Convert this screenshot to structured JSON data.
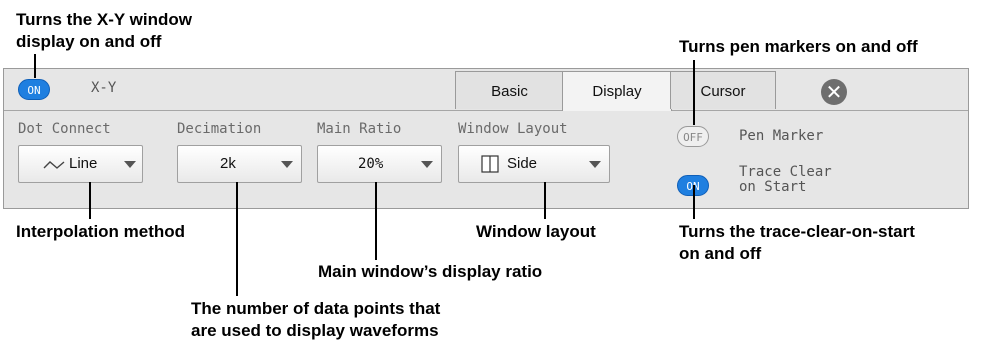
{
  "callouts": {
    "xy_toggle": "Turns the X-Y window\ndisplay on and off",
    "pen_marker": "Turns pen markers on and off",
    "interpolation": "Interpolation method",
    "window_layout": "Window layout",
    "trace_clear": "Turns the trace-clear-on-start\non and off",
    "main_ratio": "Main window’s display ratio",
    "decimation": "The number of data points that\nare used to display waveforms"
  },
  "panel": {
    "xy_toggle_state": "ON",
    "title": "X-Y",
    "tabs": [
      {
        "label": "Basic",
        "active": false
      },
      {
        "label": "Display",
        "active": true
      },
      {
        "label": "Cursor",
        "active": false
      }
    ],
    "close_icon": "close-icon",
    "fields": {
      "dot_connect": {
        "label": "Dot Connect",
        "value": "Line",
        "icon": "interpolation-line-icon"
      },
      "decimation": {
        "label": "Decimation",
        "value": "2k"
      },
      "main_ratio": {
        "label": "Main Ratio",
        "value": "20%"
      },
      "window_layout": {
        "label": "Window Layout",
        "value": "Side",
        "icon": "side-layout-icon"
      }
    },
    "pen_marker": {
      "state": "OFF",
      "label": "Pen Marker"
    },
    "trace_clear": {
      "state": "ON",
      "label": "Trace Clear\non Start"
    }
  },
  "colors": {
    "accent": "#1f7fe0",
    "panel_bg": "#e6e6e6"
  }
}
